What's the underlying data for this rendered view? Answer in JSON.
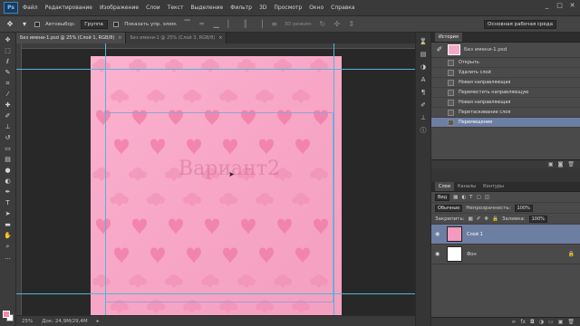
{
  "app": {
    "logo": "Ps"
  },
  "menu": [
    "Файл",
    "Редактирование",
    "Изображение",
    "Слои",
    "Текст",
    "Выделение",
    "Фильтр",
    "3D",
    "Просмотр",
    "Окно",
    "Справка"
  ],
  "window_controls": {
    "minimize": "_",
    "maximize": "□",
    "close": "✕"
  },
  "options_bar": {
    "autoselect_label": "Автовыбор:",
    "autoselect_value": "Группа",
    "show_controls_label": "Показать упр. элем.",
    "mode_3d_label": "3D-режим:",
    "workspace": "Основная рабочая среда"
  },
  "doc_tabs": [
    {
      "label": "Без имени-1.psd @ 25% (Слой 1, RGB/8)",
      "close": "×"
    },
    {
      "label": "Без имени-1 @ 25% (Слой 3, RGB/8)",
      "close": "×"
    }
  ],
  "canvas": {
    "watermark": "Вариант2"
  },
  "status": {
    "zoom": "25%",
    "doc_size": "Док: 24,9M/29,4M"
  },
  "history": {
    "tab_history": "История",
    "tab_actions": "",
    "snapshot_label": "Без имени-1.psd",
    "steps": [
      "Открыть",
      "Удалить слой",
      "Новая направляющая",
      "Переместить направляющую",
      "Новая направляющая",
      "Перетаскивание слоя",
      "Перемещение"
    ],
    "footer_icons": [
      "new-doc-icon",
      "camera-icon",
      "trash-icon"
    ]
  },
  "layers_panel": {
    "tabs": [
      "Слои",
      "Каналы",
      "Контуры"
    ],
    "filter": "Вид",
    "blend_mode": "Обычные",
    "opacity_label": "Непрозрачность:",
    "opacity": "100%",
    "lock_label": "Закрепить:",
    "fill_label": "Заливка:",
    "fill": "100%",
    "layers": [
      {
        "name": "Слой 1",
        "thumb_color": "#f39bbe",
        "active": true,
        "locked": false
      },
      {
        "name": "Фон",
        "thumb_color": "#ffffff",
        "active": false,
        "locked": true
      }
    ]
  },
  "colors": {
    "foreground": "#f28aae",
    "background": "#ffffff",
    "accent": "#6d7ea3",
    "guide": "#4fb6d8"
  }
}
